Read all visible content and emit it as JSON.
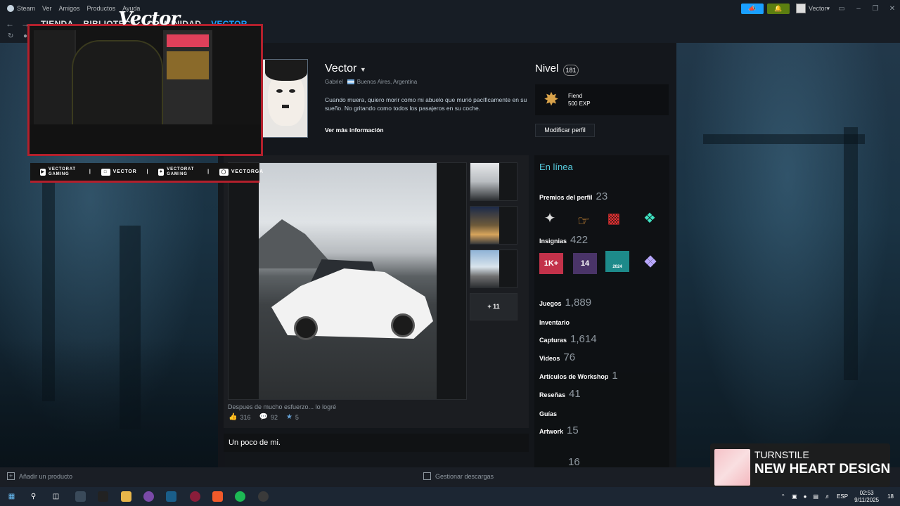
{
  "menubar": {
    "items": [
      "Steam",
      "Ver",
      "Amigos",
      "Productos",
      "Ayuda"
    ]
  },
  "account": {
    "name": "Vector"
  },
  "nav": {
    "tabs": [
      "TIENDA",
      "BIBLIOTECA",
      "COMUNIDAD",
      "VECTOR"
    ],
    "active_tab": "VECTOR"
  },
  "stream": {
    "logo": "Vector",
    "socials": [
      {
        "icon": "youtube-icon",
        "text": "VECTORAT GAMING"
      },
      {
        "icon": "twitch-icon",
        "text": "VECTOR"
      },
      {
        "icon": "twitter-icon",
        "text": "VECTORAT GAMING"
      },
      {
        "icon": "instagram-icon",
        "text": "VECTORGA"
      }
    ]
  },
  "profile": {
    "persona_name": "Vector",
    "real_name": "Gabriel",
    "location": "Buenos Aires, Argentina",
    "summary": "Cuando muera, quiero morir como mi abuelo que murió pacíficamente en su sueño. No gritando como todos los pasajeros en su coche.",
    "more_info": "Ver más información",
    "level_label": "Nivel",
    "level": "181",
    "favorite_badge": {
      "name": "Fiend",
      "xp": "500 EXP"
    },
    "edit_button": "Modificar perfil"
  },
  "showcase": {
    "more_count": "+ 11",
    "caption": "Despues de mucho esfuerzo... lo logré",
    "likes": "316",
    "comments": "92",
    "awards": "5",
    "about_title": "Un poco de mi."
  },
  "sidebar": {
    "status": "En línea",
    "awards_label": "Premios del perfil",
    "awards_count": "23",
    "badges_label": "Insignias",
    "badges_count": "422",
    "badge_texts": [
      "1K+",
      "14",
      "2024"
    ],
    "games_label": "Juegos",
    "games_count": "1,889",
    "inventory_label": "Inventario",
    "screenshots_label": "Capturas",
    "screenshots_count": "1,614",
    "videos_label": "Videos",
    "videos_count": "76",
    "workshop_label": "Artículos de Workshop",
    "workshop_count": "1",
    "reviews_label": "Reseñas",
    "reviews_count": "41",
    "guides_label": "Guías",
    "artwork_label": "Artwork",
    "artwork_count": "15",
    "partial_count": "16"
  },
  "downloads": {
    "add_product": "Añadir un producto",
    "manage": "Gestionar descargas"
  },
  "now_playing": {
    "artist": "TURNSTILE",
    "title": "NEW HEART DESIGN"
  },
  "tray": {
    "lang": "ESP",
    "time": "02:53",
    "date": "9/11/2025",
    "notif": "18"
  }
}
